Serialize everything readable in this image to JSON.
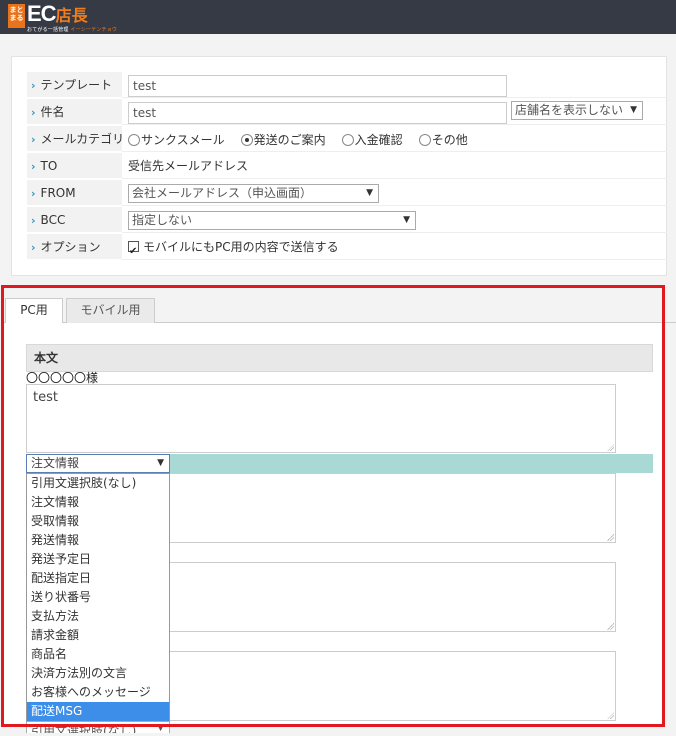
{
  "brand": {
    "badge": "まとまる",
    "main": "EC",
    "store": "店長",
    "sub_left": "おてがる一括管理",
    "sub_right": "イーシーテンチョウ"
  },
  "form": {
    "template": {
      "label": "テンプレート",
      "value": "test"
    },
    "subject": {
      "label": "件名",
      "value": "test",
      "shop_option": "店舗名を表示しない"
    },
    "category": {
      "label": "メールカテゴリ",
      "options": [
        "サンクスメール",
        "発送のご案内",
        "入金確認",
        "その他"
      ],
      "selected": "発送のご案内"
    },
    "to": {
      "label": "TO",
      "value": "受信先メールアドレス"
    },
    "from": {
      "label": "FROM",
      "value": "会社メールアドレス（申込画面）"
    },
    "bcc": {
      "label": "BCC",
      "value": "指定しない"
    },
    "option": {
      "label": "オプション",
      "checkbox_label": "モバイルにもPC用の内容で送信する",
      "checked": true
    }
  },
  "tabs": [
    {
      "label": "PC用",
      "active": true
    },
    {
      "label": "モバイル用",
      "active": false
    }
  ],
  "body": {
    "heading": "本文",
    "salutation": "〇〇〇〇〇様",
    "first_text": "test",
    "insert_select_value": "注文情報",
    "dropdown_options": [
      "引用文選択肢(なし)",
      "注文情報",
      "受取情報",
      "発送情報",
      "発送予定日",
      "配送指定日",
      "送り状番号",
      "支払方法",
      "請求金額",
      "商品名",
      "決済方法別の文言",
      "お客様へのメッセージ",
      "配送MSG"
    ],
    "dropdown_highlighted": "配送MSG",
    "bottom_select_value": "引用文選択肢(なし)"
  },
  "colors": {
    "topbar": "#353a45",
    "accent": "#ee7d1d",
    "chevron": "#3a95b9",
    "highlight_frame": "#e3181e",
    "teal_bar": "#a9d9d4",
    "dropdown_selected": "#3d8ee9"
  },
  "icons": {
    "row_marker": "chevron-right-icon",
    "select_arrow": "triangle-down-icon",
    "checkbox": "checkmark-icon"
  }
}
